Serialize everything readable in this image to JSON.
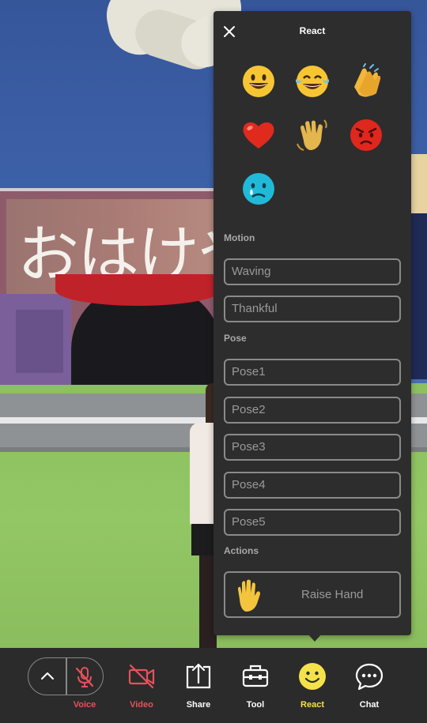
{
  "scene": {
    "sign_text": "おはけや"
  },
  "panel": {
    "title": "React",
    "close_icon": "close-icon",
    "emojis": [
      {
        "name": "grinning-face",
        "icon": "grinning-face-icon"
      },
      {
        "name": "tears-of-joy",
        "icon": "tears-of-joy-icon"
      },
      {
        "name": "clapping-hands",
        "icon": "clapping-hands-icon"
      },
      {
        "name": "red-heart",
        "icon": "red-heart-icon"
      },
      {
        "name": "waving-hand",
        "icon": "waving-hand-icon"
      },
      {
        "name": "angry-face",
        "icon": "angry-face-icon"
      },
      {
        "name": "crying-face",
        "icon": "crying-face-icon"
      }
    ],
    "motion": {
      "label": "Motion",
      "items": [
        "Waving",
        "Thankful"
      ]
    },
    "pose": {
      "label": "Pose",
      "items": [
        "Pose1",
        "Pose2",
        "Pose3",
        "Pose4",
        "Pose5"
      ]
    },
    "actions": {
      "label": "Actions",
      "raise_hand": "Raise Hand"
    }
  },
  "toolbar": {
    "voice": "Voice",
    "video": "Video",
    "share": "Share",
    "tool": "Tool",
    "react": "React",
    "chat": "Chat"
  },
  "colors": {
    "panel_bg": "#2d2d2d",
    "toolbar_bg": "#2b2b2b",
    "muted_red": "#e8515a",
    "active_yellow": "#f5e14a",
    "outline_gray": "#8a8a8a"
  }
}
